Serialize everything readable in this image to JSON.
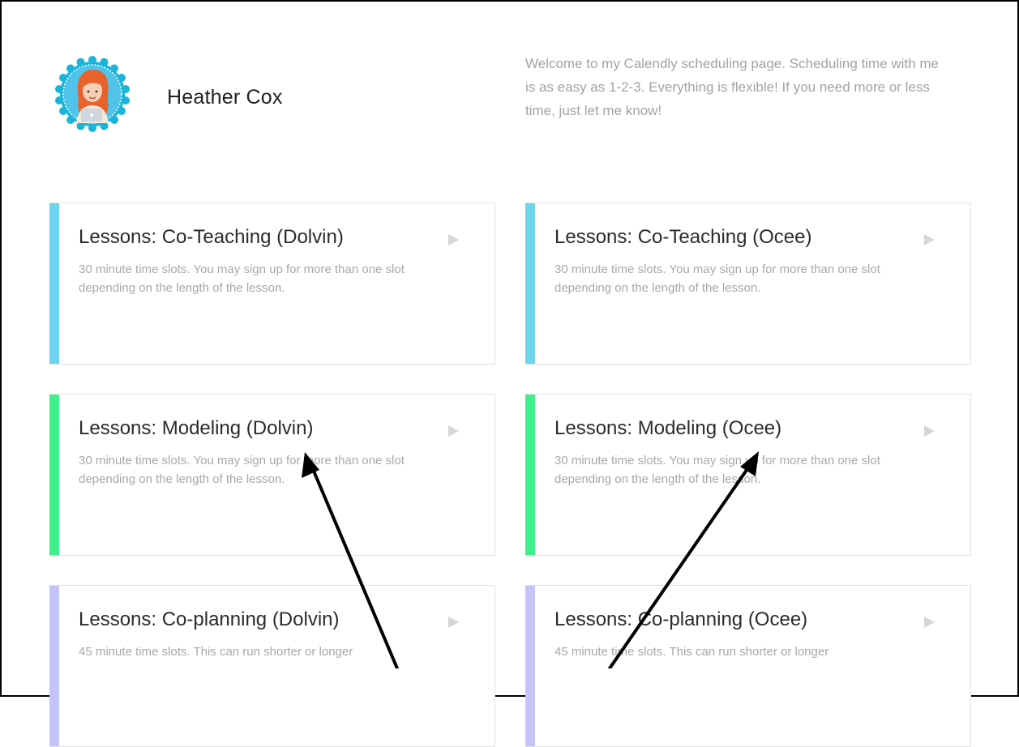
{
  "profile": {
    "name": "Heather Cox",
    "welcome": "Welcome to my Calendly scheduling page. Scheduling time with me is as easy as 1-2-3. Everything is flexible! If you need more or less time, just let me know!"
  },
  "colors": {
    "co_teaching": "#6dd5ed",
    "modeling": "#3ff08a",
    "co_planning": "#c4c4fa"
  },
  "events": [
    {
      "title": "Lessons: Co-Teaching (Dolvin)",
      "description": "30 minute time slots. You may sign up for more than one slot depending on the length of the lesson."
    },
    {
      "title": "Lessons: Co-Teaching (Ocee)",
      "description": "30 minute time slots. You may sign up for more than one slot depending on the length of the lesson."
    },
    {
      "title": "Lessons: Modeling (Dolvin)",
      "description": "30 minute time slots. You may sign up for more than one slot depending on the length of the lesson."
    },
    {
      "title": "Lessons: Modeling (Ocee)",
      "description": "30 minute time slots. You may sign up for more than one slot depending on the length of the lesson."
    },
    {
      "title": "Lessons: Co-planning (Dolvin)",
      "description": "45 minute time slots. This can run shorter or longer"
    },
    {
      "title": "Lessons: Co-planning (Ocee)",
      "description": "45 minute time slots. This can run shorter or longer"
    }
  ],
  "icons": {
    "event_arrow": "play-triangle-icon",
    "avatar": "avatar-illustration"
  }
}
